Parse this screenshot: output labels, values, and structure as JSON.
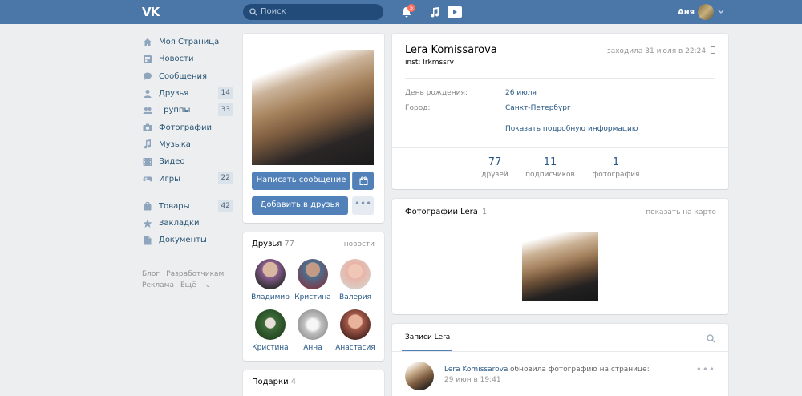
{
  "header": {
    "logo": "VK",
    "search_placeholder": "Поиск",
    "notifications_count": "5",
    "user_name": "Аня"
  },
  "sidebar": {
    "items": [
      {
        "label": "Моя Страница",
        "icon": "home-icon",
        "count": ""
      },
      {
        "label": "Новости",
        "icon": "news-icon",
        "count": ""
      },
      {
        "label": "Сообщения",
        "icon": "messages-icon",
        "count": ""
      },
      {
        "label": "Друзья",
        "icon": "friends-icon",
        "count": "14"
      },
      {
        "label": "Группы",
        "icon": "groups-icon",
        "count": "33"
      },
      {
        "label": "Фотографии",
        "icon": "camera-icon",
        "count": ""
      },
      {
        "label": "Музыка",
        "icon": "music-icon",
        "count": ""
      },
      {
        "label": "Видео",
        "icon": "video-icon",
        "count": ""
      },
      {
        "label": "Игры",
        "icon": "games-icon",
        "count": "22"
      }
    ],
    "items2": [
      {
        "label": "Товары",
        "icon": "shopping-bag-icon",
        "count": "42"
      },
      {
        "label": "Закладки",
        "icon": "star-icon",
        "count": ""
      },
      {
        "label": "Документы",
        "icon": "document-icon",
        "count": ""
      }
    ],
    "footer": [
      "Блог",
      "Разработчикам",
      "Реклама",
      "Ещё"
    ]
  },
  "profile_actions": {
    "message_button": "Написать сообщение",
    "add_friend_button": "Добавить в друзья",
    "more_button": "•••"
  },
  "friends_block": {
    "title": "Друзья",
    "count": "77",
    "link": "новости",
    "friends": [
      {
        "name": "Владимир",
        "color": "#8a5d8f"
      },
      {
        "name": "Кристина",
        "color": "#4d6f8f"
      },
      {
        "name": "Валерия",
        "color": "#e9b3a7"
      },
      {
        "name": "Кристина",
        "color": "#3e6b3a"
      },
      {
        "name": "Анна",
        "color": "#bfbfbf"
      },
      {
        "name": "Анастасия",
        "color": "#a55a4a"
      }
    ]
  },
  "gifts_block": {
    "title": "Подарки",
    "count": "4"
  },
  "profile": {
    "name": "Lera Komissarova",
    "status": "inst: lrkmssrv",
    "online": "заходила 31 июля в 22:24",
    "birthday_label": "День рождения:",
    "birthday_value": "26 июля",
    "city_label": "Город:",
    "city_value": "Санкт-Петербург",
    "more_info": "Показать подробную информацию",
    "counters": [
      {
        "num": "77",
        "label": "друзей"
      },
      {
        "num": "11",
        "label": "подписчиков"
      },
      {
        "num": "1",
        "label": "фотография"
      }
    ]
  },
  "photos_block": {
    "title": "Фотографии Lera",
    "count": "1",
    "link": "показать на карте"
  },
  "wall": {
    "tab": "Записи Lera",
    "post_author": "Lera Komissarova",
    "post_action": "обновила фотографию на странице:",
    "post_time": "29 июн в 19:41"
  },
  "colors": {
    "header": "#4a76a8",
    "button": "#5181b8",
    "link": "#2a5885"
  }
}
